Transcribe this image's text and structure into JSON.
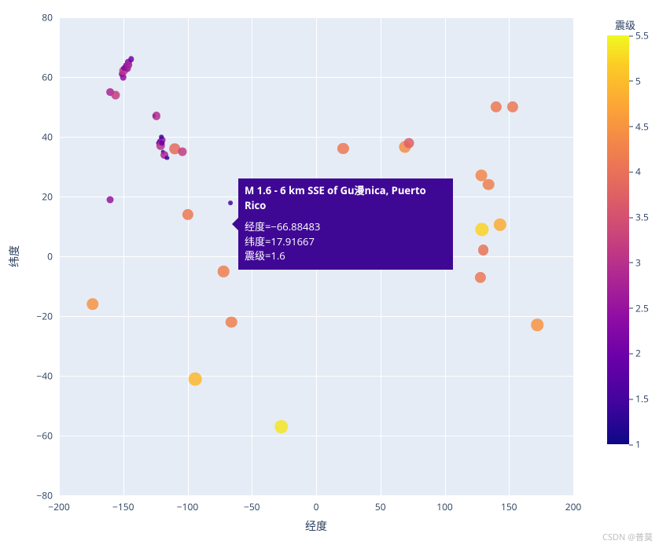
{
  "chart_data": {
    "type": "scatter",
    "xlabel": "经度",
    "ylabel": "纬度",
    "colorbar_title": "震级",
    "xlim": [
      -200,
      200
    ],
    "ylim": [
      -80,
      80
    ],
    "xticks": [
      -200,
      -150,
      -100,
      -50,
      0,
      50,
      100,
      150,
      200
    ],
    "yticks": [
      -80,
      -60,
      -40,
      -20,
      0,
      20,
      40,
      60,
      80
    ],
    "colorbar_range": [
      1,
      5.5
    ],
    "colorbar_ticks": [
      1,
      1.5,
      2,
      2.5,
      3,
      3.5,
      4,
      4.5,
      5,
      5.5
    ],
    "series": [
      {
        "name": "earthquakes",
        "points": [
          {
            "x": -66.88,
            "y": 17.92,
            "mag": 1.6
          },
          {
            "x": -174,
            "y": -16,
            "mag": 4.7
          },
          {
            "x": -160,
            "y": 19,
            "mag": 2.6
          },
          {
            "x": -160,
            "y": 55,
            "mag": 2.9
          },
          {
            "x": -156,
            "y": 54,
            "mag": 3.3
          },
          {
            "x": -151,
            "y": 61,
            "mag": 2.2
          },
          {
            "x": -150,
            "y": 60,
            "mag": 2.5
          },
          {
            "x": -150,
            "y": 62,
            "mag": 3.2
          },
          {
            "x": -149,
            "y": 63,
            "mag": 2.2
          },
          {
            "x": -148,
            "y": 64,
            "mag": 1.9
          },
          {
            "x": -147,
            "y": 63,
            "mag": 2.6
          },
          {
            "x": -146,
            "y": 65,
            "mag": 2.4
          },
          {
            "x": -146,
            "y": 64,
            "mag": 2.8
          },
          {
            "x": -144,
            "y": 66,
            "mag": 2.1
          },
          {
            "x": -126,
            "y": 47,
            "mag": 1.1
          },
          {
            "x": -124,
            "y": 47,
            "mag": 3.0
          },
          {
            "x": -123,
            "y": 38,
            "mag": 1.3
          },
          {
            "x": -122,
            "y": 38.5,
            "mag": 1.8
          },
          {
            "x": -121,
            "y": 37,
            "mag": 3.1
          },
          {
            "x": -120,
            "y": 39,
            "mag": 2.6
          },
          {
            "x": -120,
            "y": 38,
            "mag": 2.0
          },
          {
            "x": -120.5,
            "y": 40,
            "mag": 1.5
          },
          {
            "x": -119,
            "y": 35,
            "mag": 1.2
          },
          {
            "x": -118,
            "y": 34,
            "mag": 2.9
          },
          {
            "x": -116,
            "y": 33,
            "mag": 1.4
          },
          {
            "x": -110,
            "y": 36,
            "mag": 4.1
          },
          {
            "x": -104,
            "y": 35,
            "mag": 3.3
          },
          {
            "x": -100,
            "y": 14,
            "mag": 4.3
          },
          {
            "x": -94,
            "y": -41,
            "mag": 5.1
          },
          {
            "x": -72,
            "y": -5,
            "mag": 4.4
          },
          {
            "x": -66,
            "y": -22,
            "mag": 4.4
          },
          {
            "x": -27,
            "y": -57,
            "mag": 5.4
          },
          {
            "x": 21,
            "y": 36,
            "mag": 4.3
          },
          {
            "x": 69,
            "y": 36.5,
            "mag": 4.6
          },
          {
            "x": 72,
            "y": 38,
            "mag": 3.9
          },
          {
            "x": 101,
            "y": 0.5,
            "mag": 4.4
          },
          {
            "x": 128,
            "y": -7,
            "mag": 4.3
          },
          {
            "x": 128.5,
            "y": 27,
            "mag": 4.5
          },
          {
            "x": 129,
            "y": 9,
            "mag": 5.3
          },
          {
            "x": 130,
            "y": 2,
            "mag": 4.2
          },
          {
            "x": 134,
            "y": 24,
            "mag": 4.4
          },
          {
            "x": 140,
            "y": 50,
            "mag": 4.3
          },
          {
            "x": 143,
            "y": 10.5,
            "mag": 5.0
          },
          {
            "x": 153,
            "y": 50,
            "mag": 4.3
          },
          {
            "x": 172,
            "y": -23,
            "mag": 4.7
          }
        ]
      }
    ]
  },
  "tooltip": {
    "title": "M 1.6 - 6 km SSE of Gu漫nica, Puerto Rico",
    "lon_label": "经度=−66.88483",
    "lat_label": "纬度=17.91667",
    "mag_label": "震级=1.6"
  },
  "watermark": "CSDN @普莫"
}
